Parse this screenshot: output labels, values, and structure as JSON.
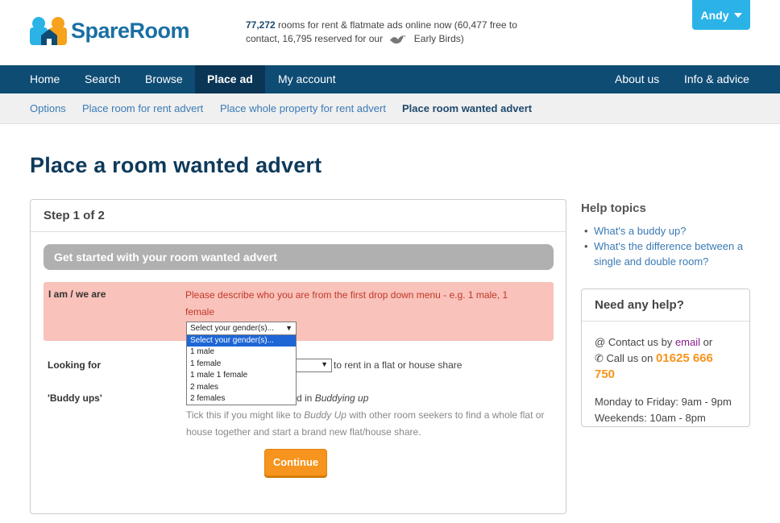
{
  "header": {
    "logo_text": "SpareRoom",
    "stats_count": "77,272",
    "stats_line1_rest": " rooms for rent & flatmate ads online now (60,477 free to",
    "stats_line2": "contact, 16,795 reserved for our",
    "early_birds": "Early Birds)",
    "user_name": "Andy"
  },
  "mainnav": {
    "home": "Home",
    "search": "Search",
    "browse": "Browse",
    "place_ad": "Place ad",
    "my_account": "My account",
    "about_us": "About us",
    "info_advice": "Info & advice"
  },
  "subnav": {
    "options": "Options",
    "room_for_rent": "Place room for rent advert",
    "whole_property": "Place whole property for rent advert",
    "room_wanted": "Place room wanted advert"
  },
  "page_title": "Place a room wanted advert",
  "form": {
    "step": "Step 1 of 2",
    "section_title": "Get started with your room wanted advert",
    "iam_label": "I am / we are",
    "error_message": "Please describe who you are from the first drop down menu - e.g. 1 male, 1 female",
    "gender_select_value": "Select your gender(s)...",
    "gender_options": [
      "Select your gender(s)...",
      "1 male",
      "1 female",
      "1 male 1 female",
      "2 males",
      "2 females"
    ],
    "looking_for_label": "Looking for",
    "looking_for_suffix": "to rent in a flat or house share",
    "buddy_label": "'Buddy ups'",
    "buddy_inline_prefix": "d in ",
    "buddy_inline_em": "Buddying up",
    "hint_1": "Tick this if you might like to ",
    "hint_em": "Buddy Up",
    "hint_2": " with other room seekers to find a whole flat or house together and start a brand new flat/house share.",
    "continue_label": "Continue"
  },
  "help_topics": {
    "title": "Help topics",
    "items": [
      "What's a buddy up?",
      "What's the difference between a single and double room?"
    ]
  },
  "need_help": {
    "title": "Need any help?",
    "contact_prefix": "Contact us by ",
    "email_label": "email",
    "contact_suffix": " or",
    "call_prefix": "Call us on ",
    "phone": "01625 666 750",
    "hours_weekday": "Monday to Friday: 9am - 9pm",
    "hours_weekend": "Weekends: 10am - 8pm"
  },
  "colors": {
    "nav_bg": "#0e4c74",
    "accent_orange": "#f7941d",
    "user_button": "#2bb3e8",
    "error_bg": "#f9c2ba"
  }
}
